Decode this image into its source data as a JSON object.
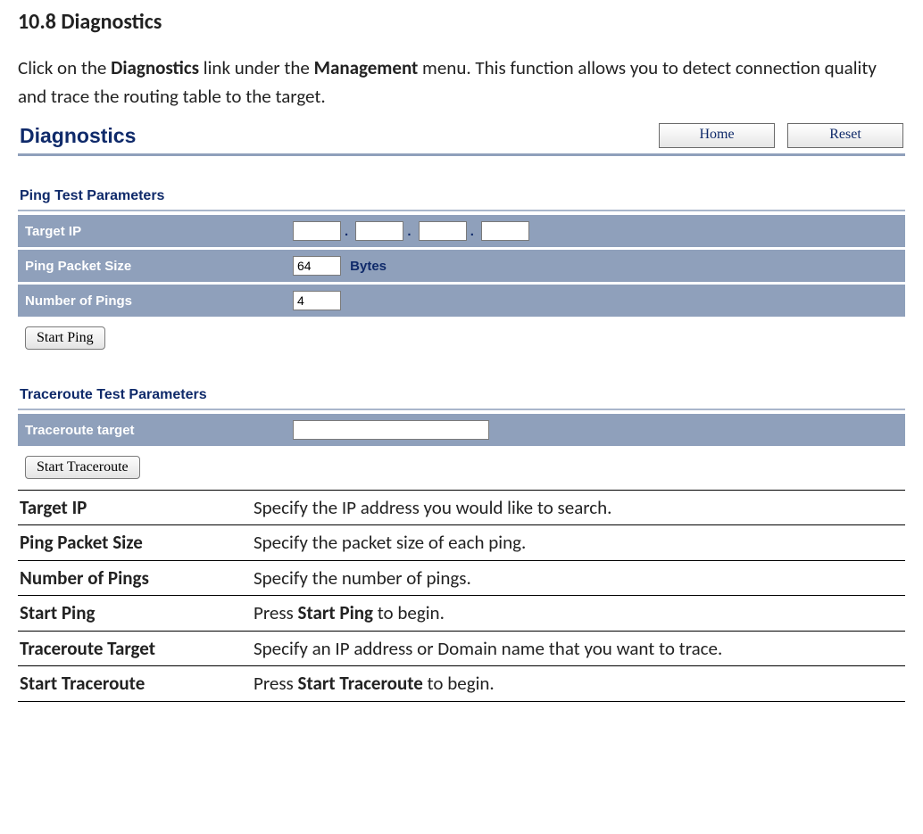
{
  "doc": {
    "heading": "10.8 Diagnostics",
    "intro_prefix": "Click on the ",
    "intro_bold1": "Diagnostics",
    "intro_mid": " link under the ",
    "intro_bold2": "Management",
    "intro_suffix": " menu. This function allows you to detect connection quality and trace the routing table to the target."
  },
  "screenshot": {
    "title": "Diagnostics",
    "home_btn": "Home",
    "reset_btn": "Reset",
    "ping_section": "Ping Test Parameters",
    "ping_rows": {
      "target_ip_label": "Target IP",
      "packet_size_label": "Ping Packet Size",
      "packet_size_value": "64",
      "packet_size_unit": "Bytes",
      "num_pings_label": "Number of Pings",
      "num_pings_value": "4"
    },
    "start_ping_btn": "Start Ping",
    "traceroute_section": "Traceroute Test Parameters",
    "traceroute_label": "Traceroute target",
    "traceroute_value": "",
    "start_traceroute_btn": "Start Traceroute"
  },
  "descriptions": [
    {
      "term": "Target IP",
      "def_pre": "Specify the IP address you would like to search.",
      "bold": "",
      "def_post": ""
    },
    {
      "term": "Ping Packet Size",
      "def_pre": "Specify the packet size of each ping.",
      "bold": "",
      "def_post": ""
    },
    {
      "term": "Number of Pings",
      "def_pre": "Specify the number of pings.",
      "bold": "",
      "def_post": ""
    },
    {
      "term": "Start Ping",
      "def_pre": "Press ",
      "bold": "Start Ping",
      "def_post": " to begin."
    },
    {
      "term": "Traceroute Target",
      "def_pre": "Specify an IP address or Domain name that you want to trace.",
      "bold": "",
      "def_post": ""
    },
    {
      "term": "Start Traceroute",
      "def_pre": "Press ",
      "bold": "Start Traceroute",
      "def_post": " to begin."
    }
  ]
}
